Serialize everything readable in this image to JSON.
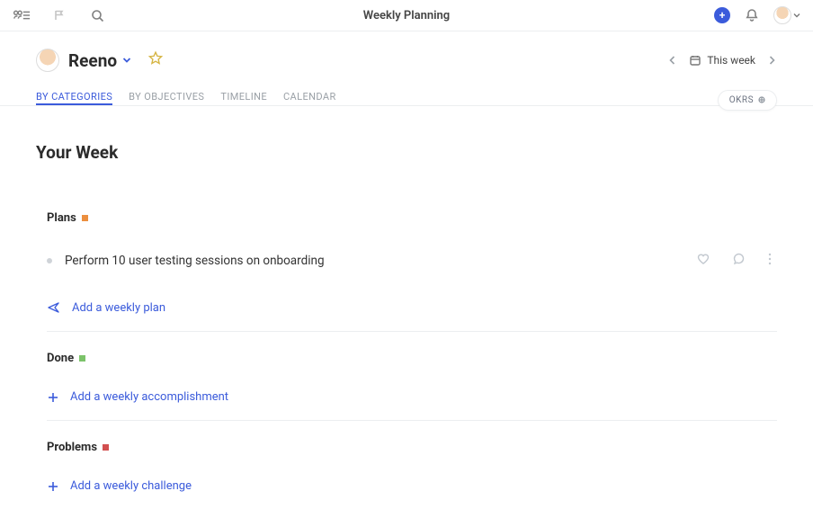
{
  "header": {
    "title": "Weekly Planning"
  },
  "user": {
    "name": "Reeno"
  },
  "week_switcher": {
    "label": "This week"
  },
  "tabs": [
    {
      "key": "by-categories",
      "label": "BY CATEGORIES",
      "active": true
    },
    {
      "key": "by-objectives",
      "label": "BY OBJECTIVES",
      "active": false
    },
    {
      "key": "timeline",
      "label": "TIMELINE",
      "active": false
    },
    {
      "key": "calendar",
      "label": "CALENDAR",
      "active": false
    }
  ],
  "okrs_chip": "OKRS",
  "page_heading": "Your Week",
  "sections": {
    "plans": {
      "title": "Plans",
      "dot": "orange",
      "items": [
        {
          "text": "Perform 10 user testing sessions on onboarding"
        }
      ],
      "add_label": "Add a weekly plan"
    },
    "done": {
      "title": "Done",
      "dot": "green",
      "items": [],
      "add_label": "Add a weekly accomplishment"
    },
    "problems": {
      "title": "Problems",
      "dot": "red",
      "items": [],
      "add_label": "Add a weekly challenge"
    }
  },
  "icons": {
    "team": "team-icon",
    "flag": "flag-icon",
    "search": "search-icon",
    "plus_circle": "plus-circle-icon",
    "bell": "bell-icon",
    "avatar": "avatar-icon",
    "caret": "caret-down-icon",
    "star": "star-icon",
    "chevron_left": "chevron-left-icon",
    "chevron_right": "chevron-right-icon",
    "calendar": "calendar-icon",
    "heart": "heart-icon",
    "comment": "comment-icon",
    "more": "more-icon",
    "send": "send-icon",
    "add": "add-icon"
  }
}
